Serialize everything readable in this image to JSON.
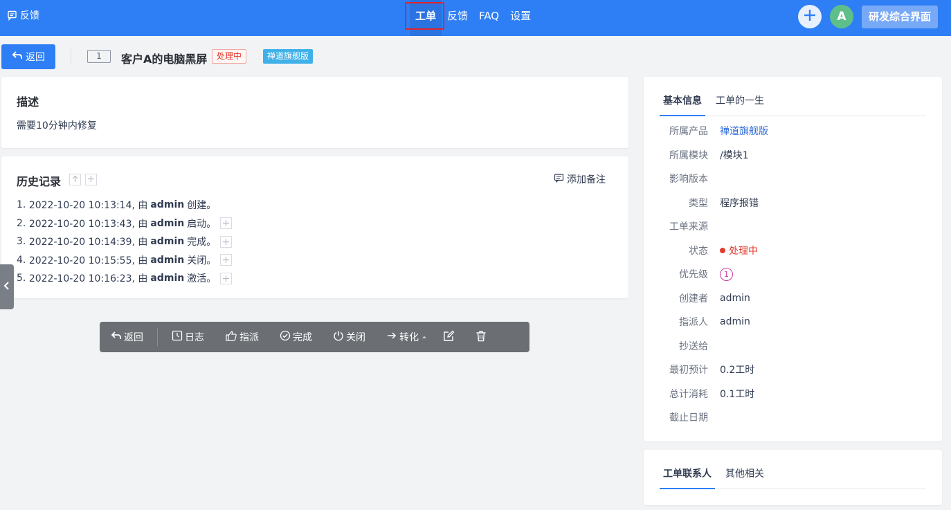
{
  "header": {
    "brand": "反馈",
    "nav": [
      "工单",
      "反馈",
      "FAQ",
      "设置"
    ],
    "active_nav": "工单",
    "avatar_letter": "A",
    "switch_label": "研发综合界面"
  },
  "titlebar": {
    "back_label": "返回",
    "id": "1",
    "title": "客户A的电脑黑屏",
    "status": "处理中",
    "product": "禅道旗舰版"
  },
  "description": {
    "title": "描述",
    "text": "需要10分钟内修复"
  },
  "history": {
    "title": "历史记录",
    "add_note": "添加备注",
    "items": [
      {
        "num": "1.",
        "time": "2022-10-20 10:13:14, 由",
        "user": "admin",
        "action": "创建。"
      },
      {
        "num": "2.",
        "time": "2022-10-20 10:13:43, 由",
        "user": "admin",
        "action": "启动。"
      },
      {
        "num": "3.",
        "time": "2022-10-20 10:14:39, 由",
        "user": "admin",
        "action": "完成。"
      },
      {
        "num": "4.",
        "time": "2022-10-20 10:15:55, 由",
        "user": "admin",
        "action": "关闭。"
      },
      {
        "num": "5.",
        "time": "2022-10-20 10:16:23, 由",
        "user": "admin",
        "action": "激活。"
      }
    ]
  },
  "toolbar": {
    "back": "返回",
    "log": "日志",
    "assign": "指派",
    "finish": "完成",
    "close": "关闭",
    "convert": "转化"
  },
  "info": {
    "tabs": [
      "基本信息",
      "工单的一生"
    ],
    "rows": [
      {
        "label": "所属产品",
        "value": "禅道旗舰版"
      },
      {
        "label": "所属模块",
        "value": "/模块1"
      },
      {
        "label": "影响版本",
        "value": ""
      },
      {
        "label": "类型",
        "value": "程序报错"
      },
      {
        "label": "工单来源",
        "value": ""
      },
      {
        "label": "状态",
        "value": "处理中"
      },
      {
        "label": "优先级",
        "value": "1"
      },
      {
        "label": "创建者",
        "value": "admin"
      },
      {
        "label": "指派人",
        "value": "admin"
      },
      {
        "label": "抄送给",
        "value": ""
      },
      {
        "label": "最初预计",
        "value": "0.2工时"
      },
      {
        "label": "总计消耗",
        "value": "0.1工时"
      },
      {
        "label": "截止日期",
        "value": ""
      }
    ]
  },
  "contacts": {
    "tabs": [
      "工单联系人",
      "其他相关"
    ]
  },
  "colors": {
    "primary": "#2e7ff6",
    "status_red": "#e33b2e",
    "product_tag": "#3fb1e8",
    "highlight": "#e3242b"
  }
}
